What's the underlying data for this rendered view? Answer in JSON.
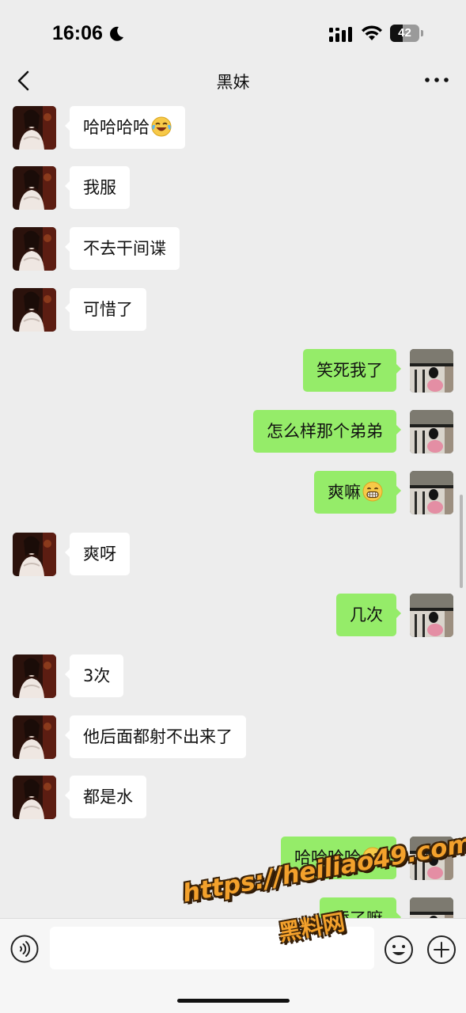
{
  "status_bar": {
    "time": "16:06",
    "battery_level": 42,
    "battery_text": "42",
    "icons": [
      "moon-icon",
      "signal-icon",
      "wifi-icon",
      "battery-icon"
    ]
  },
  "nav": {
    "title": "黑妹",
    "back_icon": "chevron-left-icon",
    "more_icon": "more-dots-icon"
  },
  "messages": [
    {
      "side": "left",
      "text": "哈哈哈哈",
      "emoji": "tears-of-joy"
    },
    {
      "side": "left",
      "text": "我服"
    },
    {
      "side": "left",
      "text": "不去干间谍"
    },
    {
      "side": "left",
      "text": "可惜了"
    },
    {
      "side": "right",
      "text": "笑死我了"
    },
    {
      "side": "right",
      "text": "怎么样那个弟弟"
    },
    {
      "side": "right",
      "text": "爽嘛",
      "emoji": "grin"
    },
    {
      "side": "left",
      "text": "爽呀"
    },
    {
      "side": "right",
      "text": "几次"
    },
    {
      "side": "left",
      "text": "3次"
    },
    {
      "side": "left",
      "text": "他后面都射不出来了"
    },
    {
      "side": "left",
      "text": "都是水"
    },
    {
      "side": "right",
      "text": "哈哈哈哈",
      "emoji": "tears-of-joy"
    },
    {
      "side": "right",
      "text": "舔了嘛"
    }
  ],
  "watermark": {
    "url": "https://heiliao49.com",
    "name": "黑料网"
  },
  "input_bar": {
    "message_value": "",
    "icons": [
      "voice-icon",
      "emoji-icon",
      "plus-icon"
    ]
  },
  "colors": {
    "background": "#ededed",
    "incoming_bubble": "#ffffff",
    "outgoing_bubble": "#95ec69",
    "watermark": "#f3a12c"
  }
}
